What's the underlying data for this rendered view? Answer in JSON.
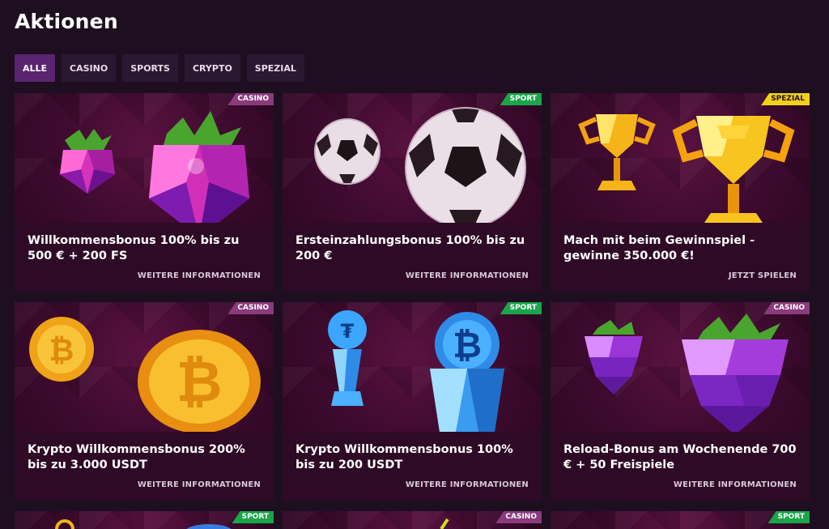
{
  "page": {
    "title": "Aktionen"
  },
  "filters": [
    {
      "label": "ALLE",
      "active": true
    },
    {
      "label": "CASINO",
      "active": false
    },
    {
      "label": "SPORTS",
      "active": false
    },
    {
      "label": "CRYPTO",
      "active": false
    },
    {
      "label": "SPEZIAL",
      "active": false
    }
  ],
  "promos": [
    {
      "badge": "CASINO",
      "title": "Willkommensbonus 100% bis zu 500 € + 200 FS",
      "link": "WEITERE INFORMATIONEN",
      "art": "raspberry-icon"
    },
    {
      "badge": "SPORT",
      "title": "Ersteinzahlungsbonus 100% bis zu 200 €",
      "link": "WEITERE INFORMATIONEN",
      "art": "soccer-ball-icon"
    },
    {
      "badge": "SPEZIAL",
      "title": "Mach mit beim Gewinnspiel - gewinne 350.000 €!",
      "link": "JETZT SPIELEN",
      "art": "trophy-icon"
    },
    {
      "badge": "CASINO",
      "title": "Krypto Willkommensbonus 200% bis zu 3.000 USDT",
      "link": "WEITERE INFORMATIONEN",
      "art": "bitcoin-coin-icon"
    },
    {
      "badge": "SPORT",
      "title": "Krypto Willkommensbonus 100% bis zu 200 USDT",
      "link": "WEITERE INFORMATIONEN",
      "art": "crypto-trophy-icon"
    },
    {
      "badge": "CASINO",
      "title": "Reload-Bonus am Wochenende 700 € + 50 Freispiele",
      "link": "WEITERE INFORMATIONEN",
      "art": "grapes-icon"
    },
    {
      "badge": "SPORT",
      "title": "",
      "link": "",
      "art": ""
    },
    {
      "badge": "CASINO",
      "title": "",
      "link": "",
      "art": ""
    },
    {
      "badge": "SPORT",
      "title": "",
      "link": "",
      "art": ""
    }
  ],
  "colors": {
    "casino_badge": "#8a3b7c",
    "sport_badge": "#1aa54a",
    "spezial_badge": "#f1d11a",
    "active_filter": "#5a2470"
  }
}
